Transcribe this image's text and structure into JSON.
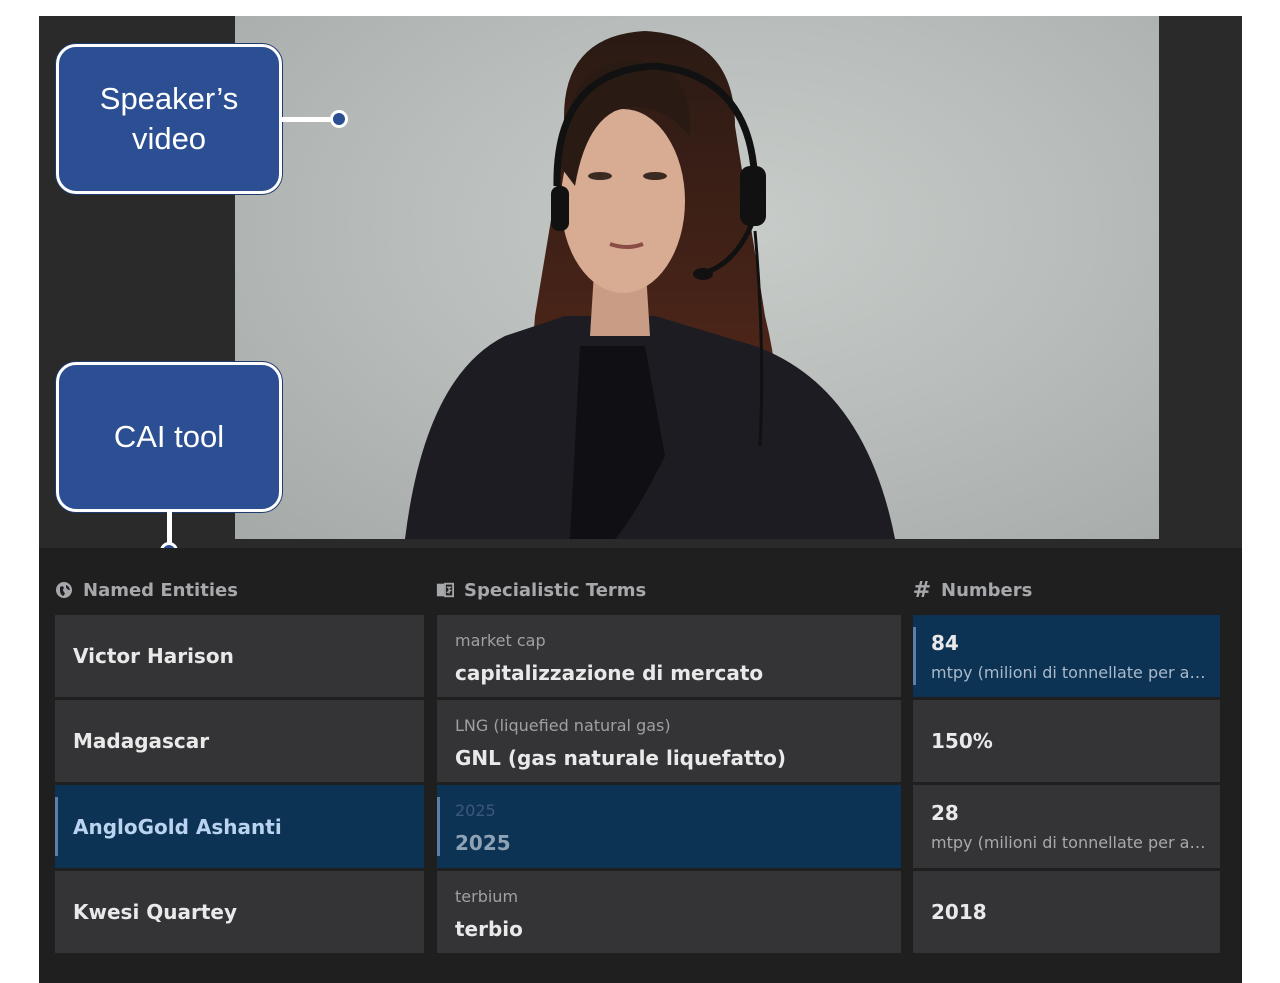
{
  "callouts": {
    "video_label": "Speaker’s\nvideo",
    "cai_label": "CAI tool"
  },
  "columns": {
    "named_entities": {
      "header": "Named Entities",
      "icon": "globe-icon",
      "items": [
        {
          "label": "Victor Harison",
          "selected": false
        },
        {
          "label": "Madagascar",
          "selected": false
        },
        {
          "label": "AngloGold Ashanti",
          "selected": true
        },
        {
          "label": "Kwesi Quartey",
          "selected": false
        }
      ]
    },
    "specialistic_terms": {
      "header": "Specialistic Terms",
      "icon": "translate-book-icon",
      "items": [
        {
          "source": "market cap",
          "target": "capitalizzazione di mercato",
          "selected": false
        },
        {
          "source": "LNG (liquefied natural gas)",
          "target": "GNL (gas naturale liquefatto)",
          "selected": false
        },
        {
          "source": "2025",
          "target": "2025",
          "selected": true
        },
        {
          "source": "terbium",
          "target": "terbio",
          "selected": false
        }
      ]
    },
    "numbers": {
      "header": "Numbers",
      "icon": "hash-icon",
      "items": [
        {
          "value": "84",
          "unit": "mtpy (milioni di tonnellate per anno)",
          "selected": true
        },
        {
          "value": "150%",
          "unit": "",
          "selected": false
        },
        {
          "value": "28",
          "unit": "mtpy (milioni di tonnellate per anno)",
          "selected": false
        },
        {
          "value": "2018",
          "unit": "",
          "selected": false
        }
      ]
    }
  },
  "colors": {
    "callout_bg": "#2c4f93",
    "panel_bg": "#1f1f20",
    "cell_bg": "#343437",
    "selected_bg": "#0d3354"
  }
}
